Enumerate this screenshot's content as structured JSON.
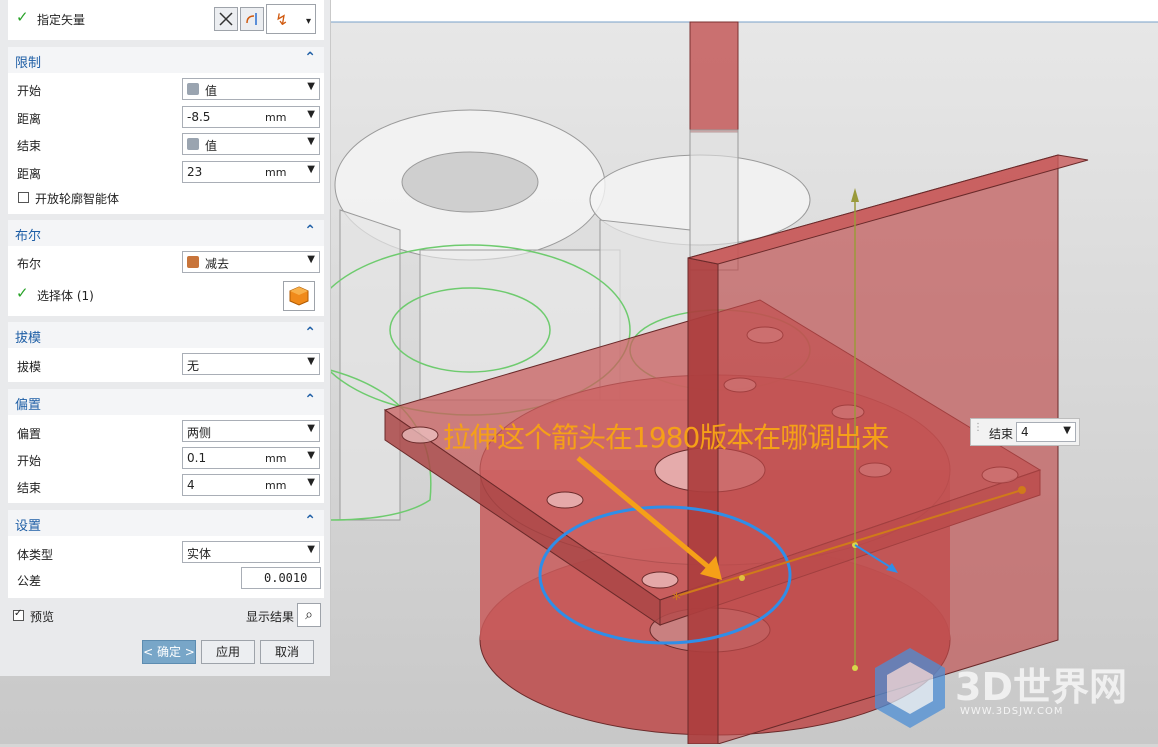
{
  "vector_row": {
    "label": "指定矢量"
  },
  "limits": {
    "title": "限制",
    "start_label": "开始",
    "start_option": "值",
    "start_dist_label": "距离",
    "start_dist_value": "-8.5",
    "start_unit": "mm",
    "end_label": "结束",
    "end_option": "值",
    "end_dist_label": "距离",
    "end_dist_value": "23",
    "end_unit": "mm",
    "open_profile_label": "开放轮廓智能体"
  },
  "boolean": {
    "title": "布尔",
    "bool_label": "布尔",
    "bool_option": "减去",
    "select_body_label": "选择体 (1)"
  },
  "draft": {
    "title": "拔模",
    "draft_label": "拔模",
    "draft_option": "无"
  },
  "offset": {
    "title": "偏置",
    "offset_label": "偏置",
    "offset_option": "两侧",
    "start_label": "开始",
    "start_value": "0.1",
    "start_unit": "mm",
    "end_label": "结束",
    "end_value": "4",
    "end_unit": "mm"
  },
  "settings": {
    "title": "设置",
    "body_type_label": "体类型",
    "body_type_option": "实体",
    "tolerance_label": "公差",
    "tolerance_value": "0.0010"
  },
  "footer": {
    "preview_label": "预览",
    "show_result_label": "显示结果",
    "ok_label": "< 确定 >",
    "apply_label": "应用",
    "cancel_label": "取消"
  },
  "viewport": {
    "callout_text": "拉伸这个箭头在1980版本在哪调出来",
    "end_popup_label": "结束",
    "end_popup_value": "4",
    "watermark_text": "3D世界网",
    "watermark_url": "WWW.3DSJW.COM"
  },
  "colors": {
    "accent": "#1f5fa6",
    "callout": "#f5a018",
    "check": "#29a329",
    "ok_button": "#78a6c8"
  }
}
